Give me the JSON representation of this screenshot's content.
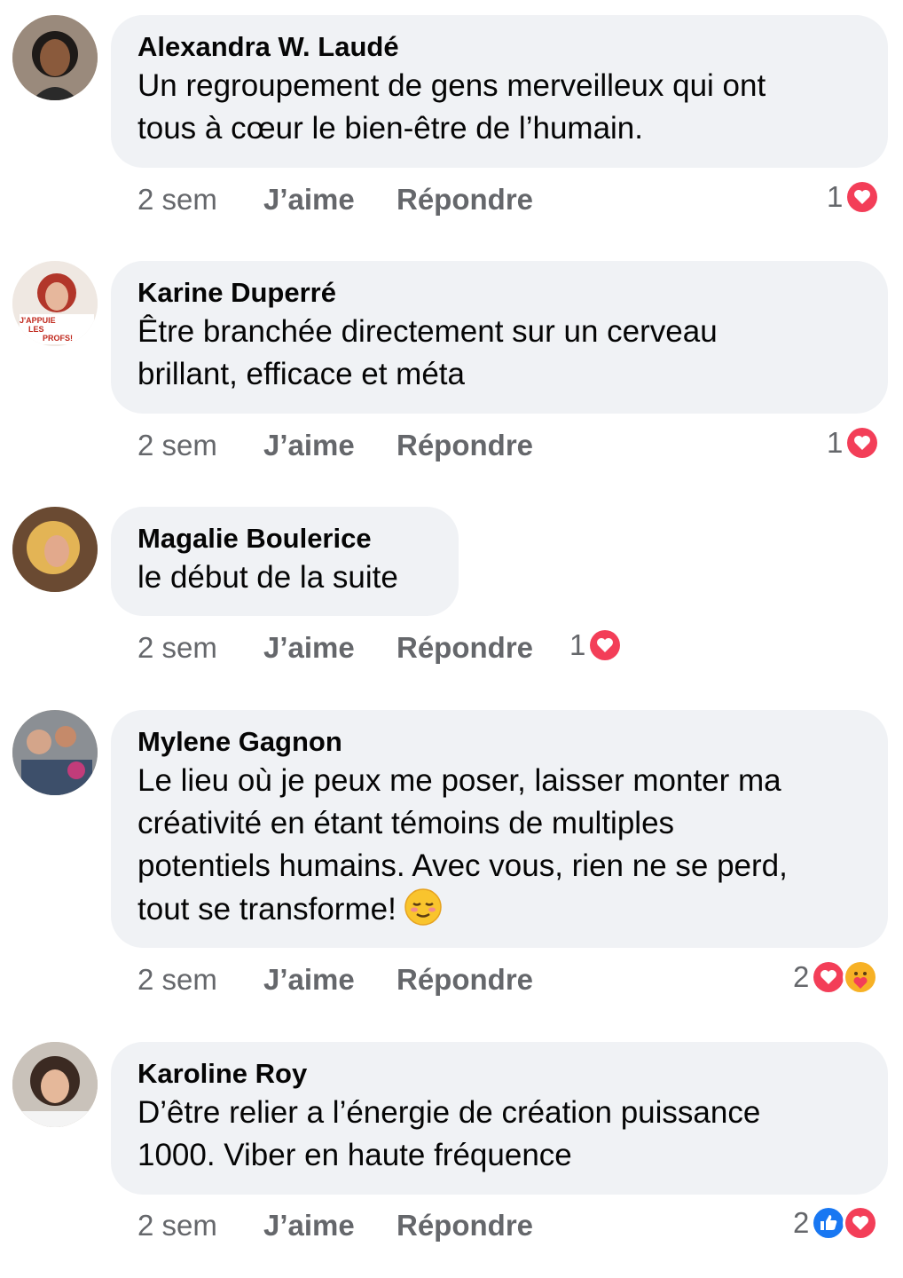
{
  "comments": [
    {
      "author": "Alexandra W. Laudé",
      "lines": [
        "Un regroupement de gens merveilleux qui ont",
        "tous à cœur le bien-être de l’humain."
      ],
      "time": "2 sem",
      "like_label": "J’aime",
      "reply_label": "Répondre",
      "reaction_count": "1",
      "reactions": [
        "love-icon"
      ]
    },
    {
      "author": "Karine Duperré",
      "lines": [
        "Être branchée directement sur un cerveau",
        "brillant, efficace et méta"
      ],
      "time": "2 sem",
      "like_label": "J’aime",
      "reply_label": "Répondre",
      "reaction_count": "1",
      "reactions": [
        "love-icon"
      ],
      "avatar_text": [
        "J'APPUIE",
        "LES",
        "PROFS!"
      ]
    },
    {
      "author": "Magalie Boulerice",
      "lines": [
        "le début de la suite"
      ],
      "time": "2 sem",
      "like_label": "J’aime",
      "reply_label": "Répondre",
      "reaction_count": "1",
      "reactions": [
        "love-icon"
      ]
    },
    {
      "author": "Mylene Gagnon",
      "lines": [
        "Le lieu où je peux me poser, laisser monter ma",
        "créativité en étant témoins de multiples",
        "potentiels humains. Avec vous, rien ne se perd,",
        "tout se transforme!"
      ],
      "inline_emoji": "relieved-face-emoji",
      "time": "2 sem",
      "like_label": "J’aime",
      "reply_label": "Répondre",
      "reaction_count": "2",
      "reactions": [
        "love-icon",
        "care-icon"
      ]
    },
    {
      "author": "Karoline Roy",
      "lines": [
        "D’être relier a l’énergie de création puissance",
        "1000. Viber en haute fréquence"
      ],
      "time": "2 sem",
      "like_label": "J’aime",
      "reply_label": "Répondre",
      "reaction_count": "2",
      "reactions": [
        "like-icon",
        "love-icon"
      ]
    }
  ],
  "colors": {
    "bubble": "#f0f2f5",
    "meta_text": "#65676b",
    "love": "#f33e58",
    "like": "#1877f2",
    "care": "#f7b125"
  }
}
